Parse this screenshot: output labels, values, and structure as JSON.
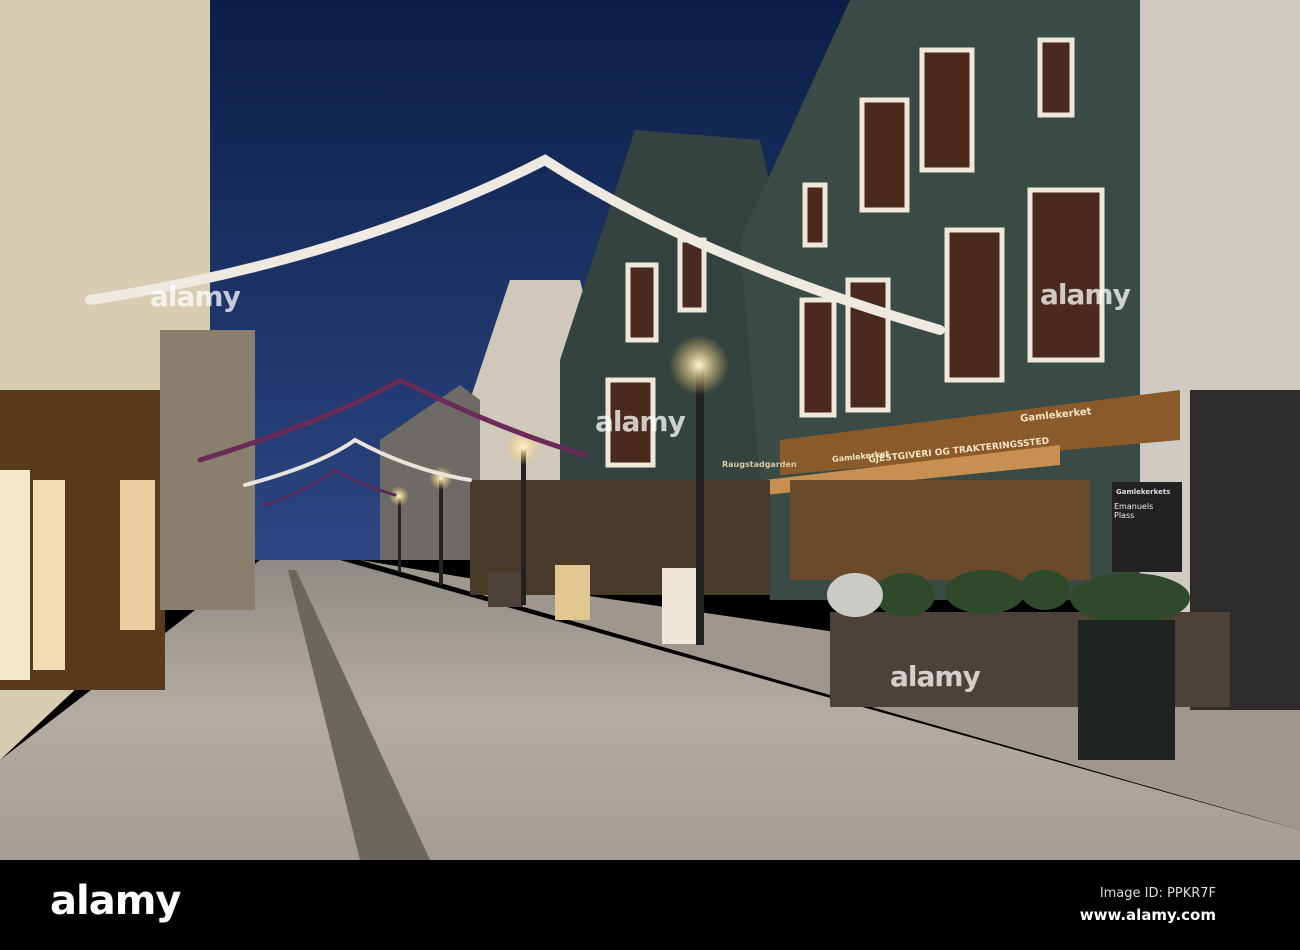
{
  "photo": {
    "description_alt": "Night street with wooden houses",
    "signs": {
      "restaurant_name_left": "Gamlekerket",
      "restaurant_banner": "GJESTGIVERI OG TRAKTERINGSSTED",
      "restaurant_name_right": "Gamlekerket",
      "chalkboard_line1": "Gamlekerkets",
      "chalkboard_line2": "Emanuels Plass",
      "raugstad": "Raugstadgarden"
    },
    "watermarks": [
      "alamy",
      "alamy",
      "alamy",
      "alamy"
    ]
  },
  "footer": {
    "logo": "alamy",
    "image_id": "Image ID: PPKR7F",
    "website": "www.alamy.com"
  },
  "colors": {
    "sky_top": "#0f2450",
    "sky_bottom": "#27407a",
    "facade_green": "#3a4a44",
    "street": "#a8a39a"
  }
}
